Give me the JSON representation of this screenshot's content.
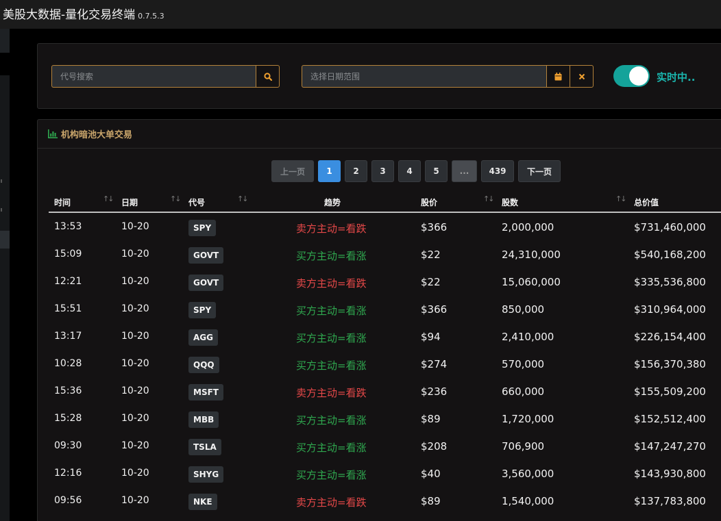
{
  "app": {
    "title": "美股大数据-量化交易终端",
    "version": "0.7.5.3"
  },
  "filters": {
    "code_search_placeholder": "代号搜索",
    "date_range_placeholder": "选择日期范围",
    "realtime_label": "实时中..",
    "realtime_on": true
  },
  "panel": {
    "title": "机构暗池大单交易"
  },
  "pagination": {
    "prev": "上一页",
    "pages": [
      "1",
      "2",
      "3",
      "4",
      "5"
    ],
    "ellipsis": "...",
    "last": "439",
    "next": "下一页",
    "current": "1"
  },
  "table": {
    "headers": {
      "time": "时间",
      "date": "日期",
      "code": "代号",
      "trend": "趋势",
      "price": "股价",
      "shares": "股数",
      "total": "总价值"
    },
    "rows": [
      {
        "time": "13:53",
        "date": "10-20",
        "code": "SPY",
        "trend": "卖方主动=看跌",
        "dir": "down",
        "price": "$366",
        "shares": "2,000,000",
        "total": "$731,460,000"
      },
      {
        "time": "15:09",
        "date": "10-20",
        "code": "GOVT",
        "trend": "买方主动=看涨",
        "dir": "up",
        "price": "$22",
        "shares": "24,310,000",
        "total": "$540,168,200"
      },
      {
        "time": "12:21",
        "date": "10-20",
        "code": "GOVT",
        "trend": "卖方主动=看跌",
        "dir": "down",
        "price": "$22",
        "shares": "15,060,000",
        "total": "$335,536,800"
      },
      {
        "time": "15:51",
        "date": "10-20",
        "code": "SPY",
        "trend": "买方主动=看涨",
        "dir": "up",
        "price": "$366",
        "shares": "850,000",
        "total": "$310,964,000"
      },
      {
        "time": "13:17",
        "date": "10-20",
        "code": "AGG",
        "trend": "买方主动=看涨",
        "dir": "up",
        "price": "$94",
        "shares": "2,410,000",
        "total": "$226,154,400"
      },
      {
        "time": "10:28",
        "date": "10-20",
        "code": "QQQ",
        "trend": "买方主动=看涨",
        "dir": "up",
        "price": "$274",
        "shares": "570,000",
        "total": "$156,370,380"
      },
      {
        "time": "15:36",
        "date": "10-20",
        "code": "MSFT",
        "trend": "卖方主动=看跌",
        "dir": "down",
        "price": "$236",
        "shares": "660,000",
        "total": "$155,509,200"
      },
      {
        "time": "15:28",
        "date": "10-20",
        "code": "MBB",
        "trend": "买方主动=看涨",
        "dir": "up",
        "price": "$89",
        "shares": "1,720,000",
        "total": "$152,512,400"
      },
      {
        "time": "09:30",
        "date": "10-20",
        "code": "TSLA",
        "trend": "买方主动=看涨",
        "dir": "up",
        "price": "$208",
        "shares": "706,900",
        "total": "$147,247,270"
      },
      {
        "time": "12:16",
        "date": "10-20",
        "code": "SHYG",
        "trend": "买方主动=看涨",
        "dir": "up",
        "price": "$40",
        "shares": "3,560,000",
        "total": "$143,930,800"
      },
      {
        "time": "09:56",
        "date": "10-20",
        "code": "NKE",
        "trend": "卖方主动=看跌",
        "dir": "down",
        "price": "$89",
        "shares": "1,540,000",
        "total": "$137,783,800"
      }
    ]
  },
  "colors": {
    "accent": "#f0a030",
    "up": "#2fa84f",
    "down": "#e54848",
    "toggle": "#14a39a",
    "page_active": "#3a8ee0"
  },
  "icons": {
    "search": "search-icon",
    "calendar": "calendar-icon",
    "clear": "close-icon",
    "panel": "bar-chart-icon",
    "sort": "sort-icon"
  }
}
